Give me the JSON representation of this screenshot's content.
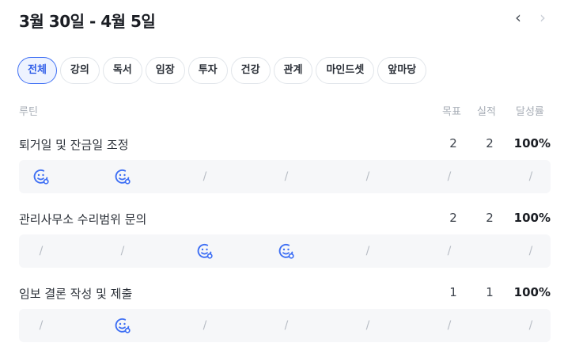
{
  "header": {
    "title": "3월 30일 - 4월 5일",
    "prev_icon": "‹",
    "next_icon": "›"
  },
  "filters": [
    {
      "label": "전체",
      "active": true
    },
    {
      "label": "강의",
      "active": false
    },
    {
      "label": "독서",
      "active": false
    },
    {
      "label": "임장",
      "active": false
    },
    {
      "label": "투자",
      "active": false
    },
    {
      "label": "건강",
      "active": false
    },
    {
      "label": "관계",
      "active": false
    },
    {
      "label": "마인드셋",
      "active": false
    },
    {
      "label": "앞마당",
      "active": false
    }
  ],
  "table_header": {
    "routine": "루틴",
    "goal": "목표",
    "actual": "실적",
    "rate": "달성률"
  },
  "routines": [
    {
      "name": "퇴거일 및 잔금일 조정",
      "goal": "2",
      "actual": "2",
      "rate": "100%",
      "days": [
        "done",
        "done",
        "/",
        "/",
        "/",
        "/",
        "/"
      ]
    },
    {
      "name": "관리사무소 수리범위 문의",
      "goal": "2",
      "actual": "2",
      "rate": "100%",
      "days": [
        "/",
        "/",
        "done",
        "done",
        "/",
        "/",
        "/"
      ]
    },
    {
      "name": "임보 결론 작성 및 제출",
      "goal": "1",
      "actual": "1",
      "rate": "100%",
      "days": [
        "/",
        "done",
        "/",
        "/",
        "/",
        "/",
        "/"
      ]
    }
  ],
  "icons": {
    "done": "smiley-check-icon",
    "prev": "chevron-left-icon",
    "next": "chevron-right-icon"
  },
  "colors": {
    "accent": "#2f5de8",
    "active_chip_bg": "#eef3ff",
    "muted": "#b7bcc4"
  }
}
